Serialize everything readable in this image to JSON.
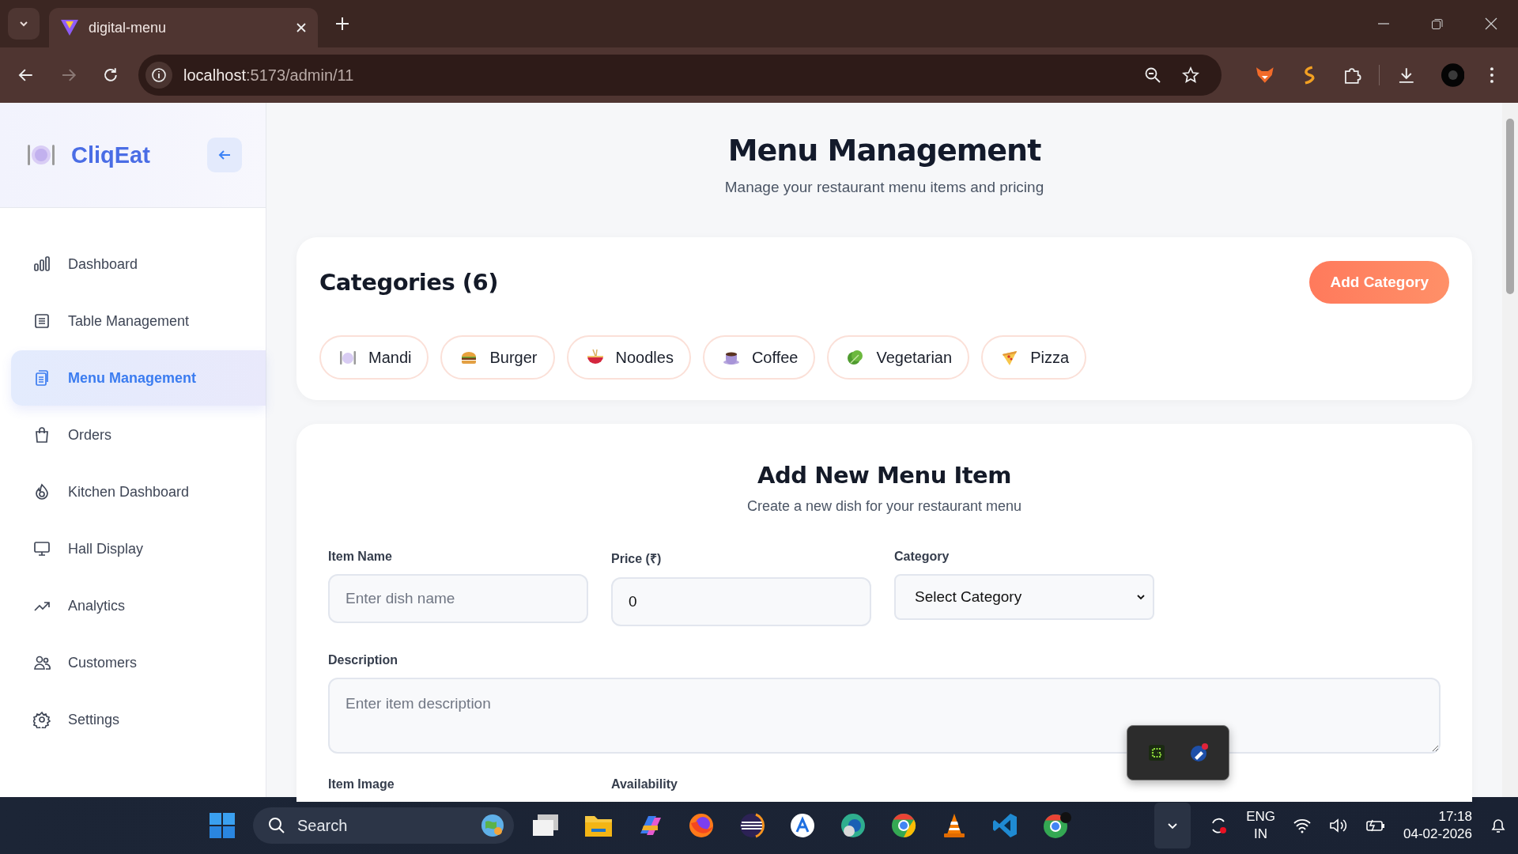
{
  "browser": {
    "tab": {
      "title": "digital-menu",
      "selected": true
    },
    "url_host": "localhost",
    "url_path": ":5173/admin/11"
  },
  "sidebar": {
    "brand": "CliqEat",
    "items": [
      {
        "label": "Dashboard",
        "selected": false
      },
      {
        "label": "Table Management",
        "selected": false
      },
      {
        "label": "Menu Management",
        "selected": true
      },
      {
        "label": "Orders",
        "selected": false
      },
      {
        "label": "Kitchen Dashboard",
        "selected": false
      },
      {
        "label": "Hall Display",
        "selected": false
      },
      {
        "label": "Analytics",
        "selected": false
      },
      {
        "label": "Customers",
        "selected": false
      },
      {
        "label": "Settings",
        "selected": false
      }
    ]
  },
  "page": {
    "title": "Menu Management",
    "subtitle": "Manage your restaurant menu items and pricing"
  },
  "categories": {
    "heading": "Categories (6)",
    "add_button": "Add Category",
    "chips": [
      "Mandi",
      "Burger",
      "Noodles",
      "Coffee",
      "Vegetarian",
      "Pizza"
    ]
  },
  "form": {
    "heading": "Add New Menu Item",
    "subtitle": "Create a new dish for your restaurant menu",
    "item_name": {
      "label": "Item Name",
      "placeholder": "Enter dish name"
    },
    "price": {
      "label": "Price (₹)",
      "value": "0"
    },
    "category": {
      "label": "Category",
      "value": "Select Category"
    },
    "description": {
      "label": "Description",
      "placeholder": "Enter item description"
    },
    "item_image": {
      "label": "Item Image"
    },
    "availability": {
      "label": "Availability"
    }
  },
  "taskbar": {
    "search_placeholder": "Search",
    "language": "ENG",
    "region": "IN",
    "time": "17:18",
    "date": "04-02-2026"
  }
}
